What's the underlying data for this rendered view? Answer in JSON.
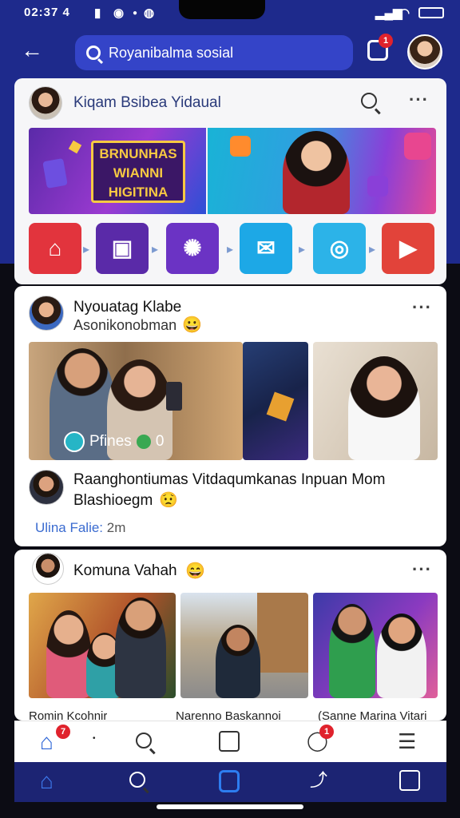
{
  "status": {
    "time": "02:37 4",
    "icons": [
      "sim-icon",
      "clock-icon",
      "dot-icon",
      "signal-icon",
      "wifi-icon",
      "battery-icon"
    ]
  },
  "topbar": {
    "search_text": "Royanibalma sosial",
    "message_badge": "1"
  },
  "post1": {
    "title": "Kiqam Bsibea Yidaual",
    "banner_text": "BRNUNHAS WIANNI HIGITINA",
    "apps": [
      "home",
      "media",
      "settings",
      "map",
      "circle",
      "play"
    ]
  },
  "post2": {
    "name": "Nyouatag Klabe",
    "sub": "Asonikonobman",
    "image_caption": "Pfines",
    "image_count": "0",
    "body_line1": "Raanghontiumas Vitdaqumkanas Inpuan Mom",
    "body_line2": "Blashioegm",
    "meta_label": "Ulina Falie:",
    "meta_time": "2m"
  },
  "post3": {
    "name": "Komuna Vahah",
    "caption_left": "Romin Kcohnir",
    "caption_mid": "Narenno Baskannoi",
    "caption_right": "(Sanne Marina Vitari"
  },
  "nav": {
    "home_badge": "7",
    "bell_badge": "1",
    "items": [
      "home",
      "search",
      "create",
      "notifications",
      "menu"
    ],
    "bottom_items": [
      "home",
      "search",
      "camera",
      "share",
      "bookmark"
    ]
  },
  "colors": {
    "primary": "#1e2a8c",
    "accent": "#3444c8",
    "badge": "#e0222c"
  }
}
